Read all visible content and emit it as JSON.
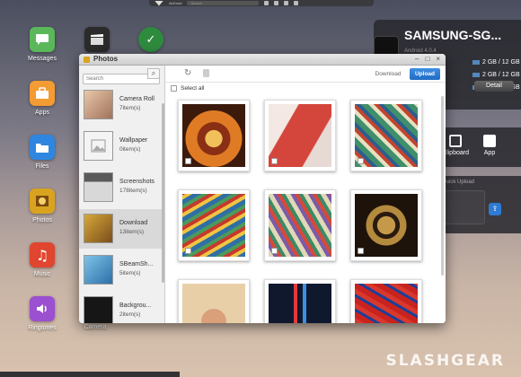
{
  "topbar": {
    "brand": "AirDroid",
    "search_placeholder": "Search"
  },
  "desktop_icons": [
    {
      "label": "Messages",
      "color": "#5bb85a"
    },
    {
      "label": "Apps",
      "color": "#f39c33"
    },
    {
      "label": "Files",
      "color": "#2f86e0"
    },
    {
      "label": "Photos",
      "color": "#d9a320"
    },
    {
      "label": "Music",
      "color": "#e0452f"
    },
    {
      "label": "Ringtones",
      "color": "#9b4fd1"
    },
    {
      "label": "Camera",
      "color": "#555555"
    }
  ],
  "device": {
    "name": "SAMSUNG-SG...",
    "os": "Android 4.0.4",
    "storage": [
      "2 GB / 12 GB",
      "2 GB / 12 GB",
      "2 GB / 12 GB"
    ],
    "detail_label": "Detail"
  },
  "tools": {
    "clipboard": "Clipboard",
    "app": "App"
  },
  "upload_panel": {
    "title": "Quick Upload"
  },
  "window": {
    "title": "Photos",
    "search_placeholder": "Search",
    "download_label": "Download",
    "upload_label": "Upload",
    "select_all": "Select all",
    "close": "×",
    "minimize": "–",
    "maximize": "□"
  },
  "albums": [
    {
      "name": "Camera Roll",
      "count": "7item(s)"
    },
    {
      "name": "Wallpaper",
      "count": "0item(s)"
    },
    {
      "name": "Screenshots",
      "count": "178item(s)"
    },
    {
      "name": "Download",
      "count": "13item(s)",
      "selected": true
    },
    {
      "name": "SBeamSh...",
      "count": "5item(s)"
    },
    {
      "name": "Backgrou...",
      "count": "2item(s)"
    }
  ],
  "watermark": "SLASHGEAR",
  "colors": {
    "accent": "#1f6cc3",
    "window_bg": "#ffffff",
    "sidebar_bg": "#f0f0f0"
  }
}
